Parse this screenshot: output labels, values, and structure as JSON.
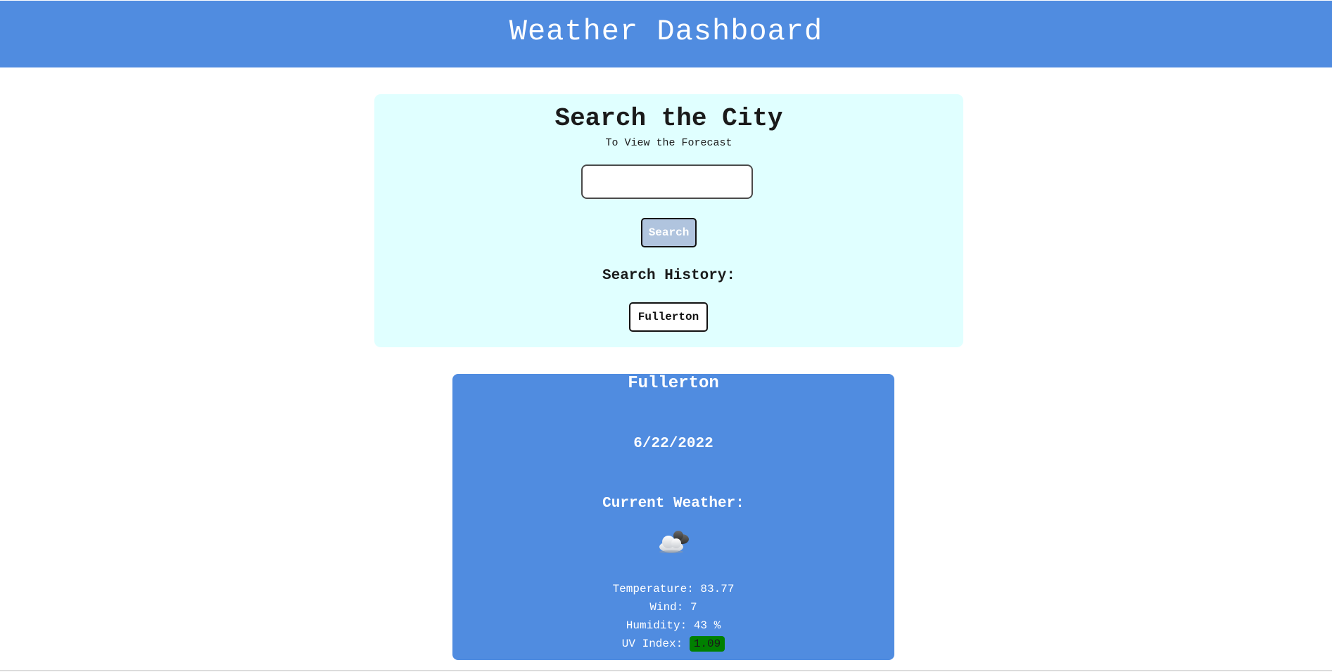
{
  "header": {
    "title": "Weather Dashboard"
  },
  "search": {
    "title": "Search the City",
    "subtitle": "To View the Forecast",
    "input_value": "",
    "input_placeholder": "",
    "button_label": "Search"
  },
  "history": {
    "heading": "Search History:",
    "items": [
      {
        "label": "Fullerton"
      }
    ]
  },
  "weather": {
    "city": "Fullerton",
    "date": "6/22/2022",
    "current_heading": "Current Weather:",
    "icon": "cloud-sun-icon",
    "temperature_label": "Temperature:",
    "temperature_value": "83.77",
    "wind_label": "Wind:",
    "wind_value": "7",
    "humidity_label": "Humidity:",
    "humidity_value": "43 %",
    "uv_label": "UV Index:",
    "uv_value": "1.09"
  },
  "colors": {
    "header_bg": "#508ce0",
    "search_panel_bg": "#e0ffff",
    "search_button_bg": "#b0c4de",
    "card_bg": "#508ce0",
    "uv_low": "#008000"
  }
}
